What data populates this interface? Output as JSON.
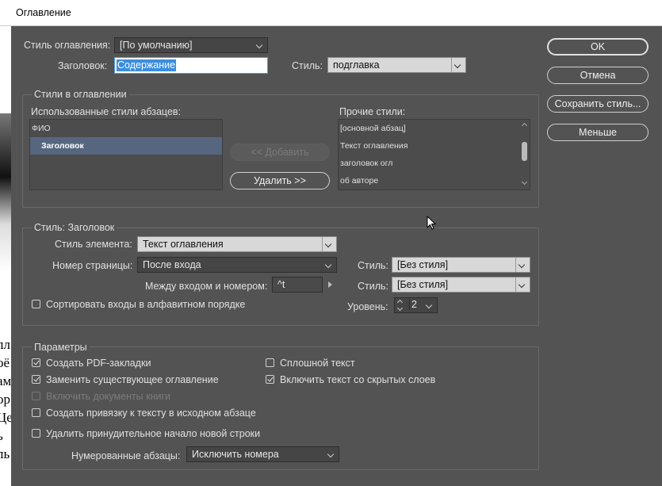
{
  "window": {
    "title": "Оглавление"
  },
  "background_doc": {
    "text_lines": [
      "лл",
      "оё",
      "ам",
      "ор",
      "Це",
      "ь",
      "ль"
    ]
  },
  "toc_style": {
    "label": "Стиль оглавления:",
    "value": "[По умолчанию]"
  },
  "heading": {
    "label": "Заголовок:",
    "value": "Содержание"
  },
  "heading_style": {
    "label": "Стиль:",
    "value": "подглавка"
  },
  "styles_group": {
    "title": "Стили в оглавлении",
    "used_label": "Использованные стили абзацев:",
    "used_items": [
      "ФИО",
      "Заголовок"
    ],
    "other_label": "Прочие стили:",
    "other_items": [
      "[основной абзац]",
      "Текст оглавления",
      "заголовок огл",
      "об авторе"
    ],
    "add_button": "<< Добавить",
    "remove_button": "Удалить >>"
  },
  "style_group": {
    "title": "Стиль: Заголовок",
    "entry_style_label": "Стиль элемента:",
    "entry_style_value": "Текст оглавления",
    "page_number_label": "Номер страницы:",
    "page_number_value": "После входа",
    "page_number_style_label": "Стиль:",
    "page_number_style_value": "[Без стиля]",
    "between_label": "Между входом и номером:",
    "between_value": "^t",
    "between_style_label": "Стиль:",
    "between_style_value": "[Без стиля]",
    "sort_label": "Сортировать входы в алфавитном порядке",
    "level_label": "Уровень:",
    "level_value": "2"
  },
  "options_group": {
    "title": "Параметры",
    "pdf_bookmarks": "Создать PDF-закладки",
    "replace_existing": "Заменить существующее оглавление",
    "include_book": "Включить документы книги",
    "create_anchor": "Создать привязку к тексту в исходном абзаце",
    "remove_forced_break": "Удалить принудительное начало новой строки",
    "run_in": "Сплошной текст",
    "include_hidden": "Включить текст со скрытых слоев",
    "numbered_label": "Нумерованные абзацы:",
    "numbered_value": "Исключить номера"
  },
  "buttons": {
    "ok": "OK",
    "cancel": "Отмена",
    "save_style": "Сохранить стиль...",
    "fewer": "Меньше"
  }
}
